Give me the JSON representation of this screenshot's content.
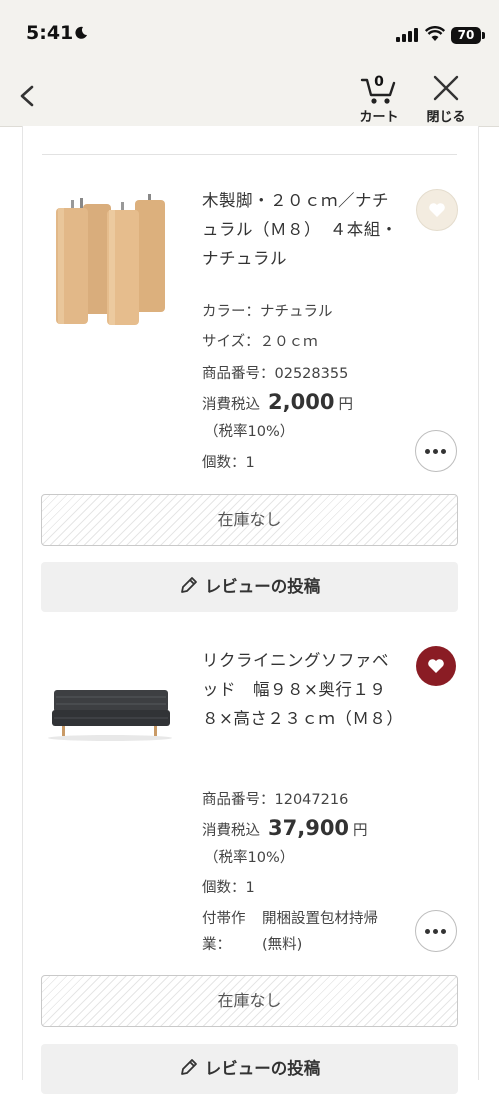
{
  "status_bar": {
    "time": "5:41",
    "battery": "70"
  },
  "nav": {
    "cart_count": "0",
    "cart_label": "カート",
    "close_label": "閉じる"
  },
  "items": [
    {
      "title": "木製脚・２０ｃｍ／ナチュラル（Ｍ８）　４本組・ナチュラル",
      "color": "カラー：ナチュラル",
      "size": "サイズ：２０ｃｍ",
      "product_no": "商品番号：02528355",
      "price_prefix": "消費税込",
      "price": "2,000",
      "price_unit": "円",
      "tax_note": "（税率10%）",
      "quantity": "個数：1",
      "favorited": false,
      "stock_label": "在庫なし",
      "review_label": "レビューの投稿"
    },
    {
      "title": "リクライニングソファベッド　幅９８×奥行１９８×高さ２３ｃｍ（Ｍ８）",
      "product_no": "商品番号：12047216",
      "price_prefix": "消費税込",
      "price": "37,900",
      "price_unit": "円",
      "tax_note": "（税率10%）",
      "quantity": "個数：1",
      "option_label": "付帯作業：",
      "option_value": "開梱設置包材持帰(無料)",
      "favorited": true,
      "stock_label": "在庫なし",
      "review_label": "レビューの投稿"
    }
  ]
}
